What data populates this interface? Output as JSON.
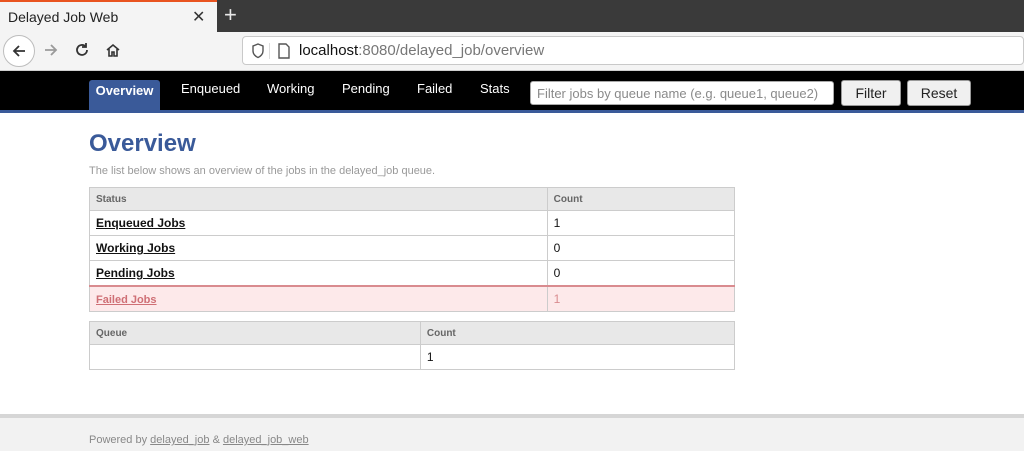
{
  "browser": {
    "tab_title": "Delayed Job Web",
    "url_host": "localhost",
    "url_rest": ":8080/delayed_job/overview"
  },
  "nav": {
    "items": [
      "Overview",
      "Enqueued",
      "Working",
      "Pending",
      "Failed",
      "Stats"
    ],
    "filter_placeholder": "Filter jobs by queue name (e.g. queue1, queue2)",
    "filter_button": "Filter",
    "reset_button": "Reset"
  },
  "page": {
    "title": "Overview",
    "subtitle": "The list below shows an overview of the jobs in the delayed_job queue."
  },
  "status_table": {
    "headers": [
      "Status",
      "Count"
    ],
    "rows": [
      {
        "label": "Enqueued Jobs",
        "count": "1"
      },
      {
        "label": "Working Jobs",
        "count": "0"
      },
      {
        "label": "Pending Jobs",
        "count": "0"
      },
      {
        "label": "Failed Jobs",
        "count": "1"
      }
    ]
  },
  "queue_table": {
    "headers": [
      "Queue",
      "Count"
    ],
    "rows": [
      {
        "queue": "",
        "count": "1"
      }
    ]
  },
  "footer": {
    "prefix": "Powered by",
    "link1": "delayed_job",
    "amp": "&",
    "link2": "delayed_job_web"
  }
}
